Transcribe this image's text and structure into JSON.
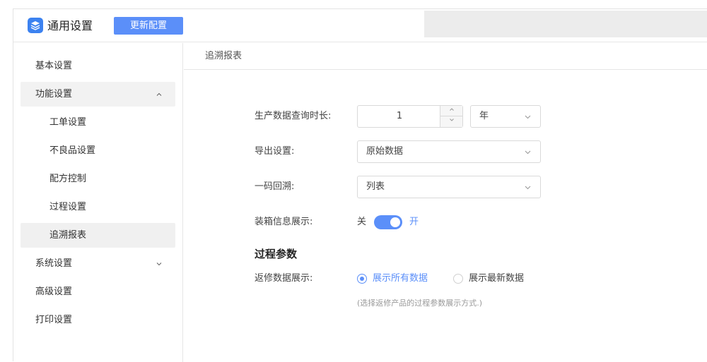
{
  "header": {
    "title": "通用设置",
    "update_button": "更新配置"
  },
  "sidebar": {
    "items": [
      {
        "label": "基本设置",
        "chevron": ""
      },
      {
        "label": "功能设置",
        "chevron": "^"
      },
      {
        "label": "工单设置"
      },
      {
        "label": "不良品设置"
      },
      {
        "label": "配方控制"
      },
      {
        "label": "过程设置"
      },
      {
        "label": "追溯报表"
      },
      {
        "label": "系统设置",
        "chevron": "v"
      },
      {
        "label": "高级设置"
      },
      {
        "label": "打印设置"
      }
    ]
  },
  "main": {
    "tab": "追溯报表",
    "query_duration": {
      "label": "生产数据查询时长:",
      "value": "1",
      "unit": "年"
    },
    "export": {
      "label": "导出设置:",
      "value": "原始数据"
    },
    "trace": {
      "label": "一码回溯:",
      "value": "列表"
    },
    "packing": {
      "label": "装箱信息展示:",
      "off": "关",
      "on": "开",
      "enabled": true
    },
    "process_section": "过程参数",
    "rework": {
      "label": "返修数据展示:",
      "options": [
        "展示所有数据",
        "展示最新数据"
      ],
      "selected": 0,
      "hint": "(选择返修产品的过程参数展示方式.)"
    }
  },
  "colors": {
    "accent": "#5b8ff9",
    "logo": "#3c82f0"
  }
}
